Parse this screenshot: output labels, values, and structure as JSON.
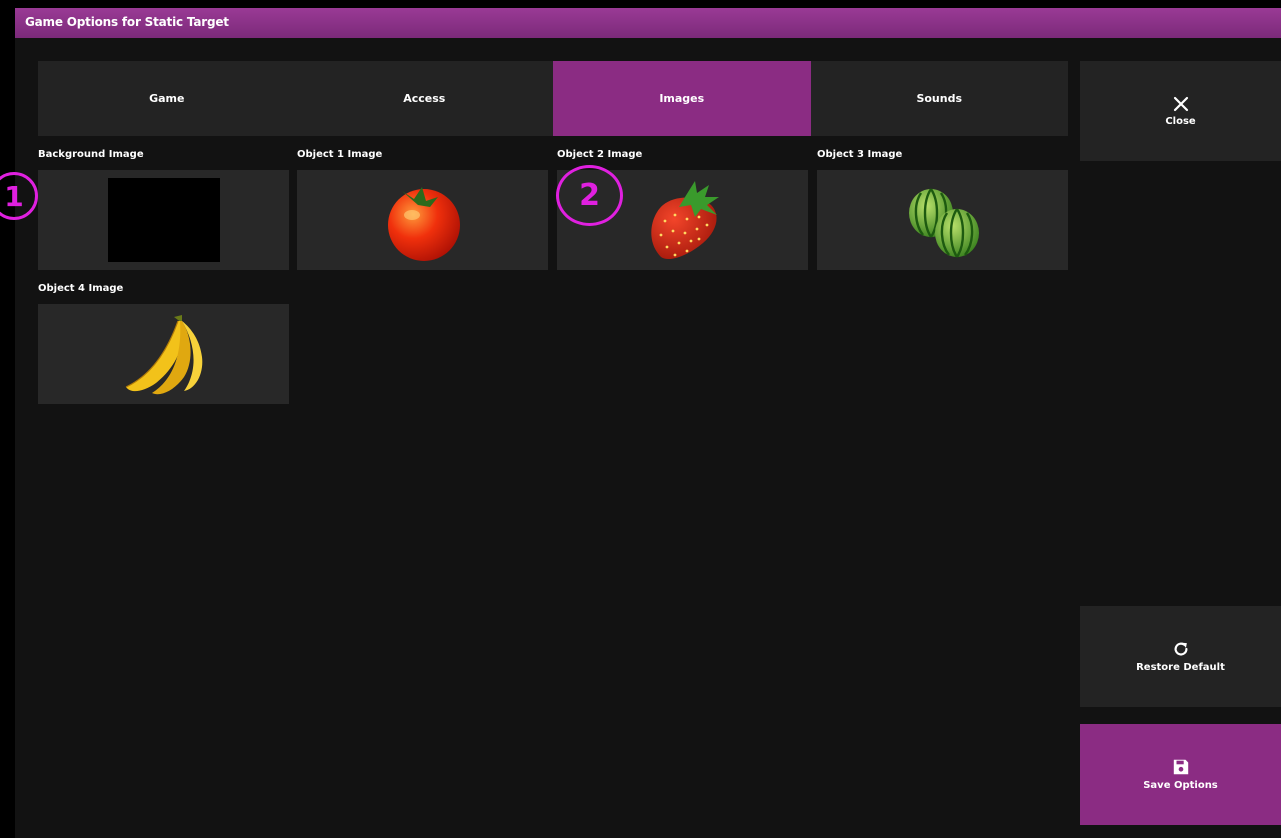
{
  "window": {
    "title": "Game Options for Static Target"
  },
  "tabs": [
    {
      "label": "Game",
      "active": false
    },
    {
      "label": "Access",
      "active": false
    },
    {
      "label": "Images",
      "active": true
    },
    {
      "label": "Sounds",
      "active": false
    }
  ],
  "images": [
    {
      "label": "Background Image",
      "content": "black-swatch"
    },
    {
      "label": "Object 1 Image",
      "content": "tomato-icon"
    },
    {
      "label": "Object 2 Image",
      "content": "strawberry-icon"
    },
    {
      "label": "Object 3 Image",
      "content": "watermelon-icon"
    },
    {
      "label": "Object 4 Image",
      "content": "banana-icon"
    }
  ],
  "buttons": {
    "close_label": "Close",
    "restore_label": "Restore Default",
    "save_label": "Save Options"
  },
  "annotations": [
    "1",
    "2"
  ],
  "colors": {
    "accent": "#8b2c83",
    "panel": "#232323",
    "tile": "#282828",
    "background": "#121212",
    "marker": "#e020e0"
  }
}
